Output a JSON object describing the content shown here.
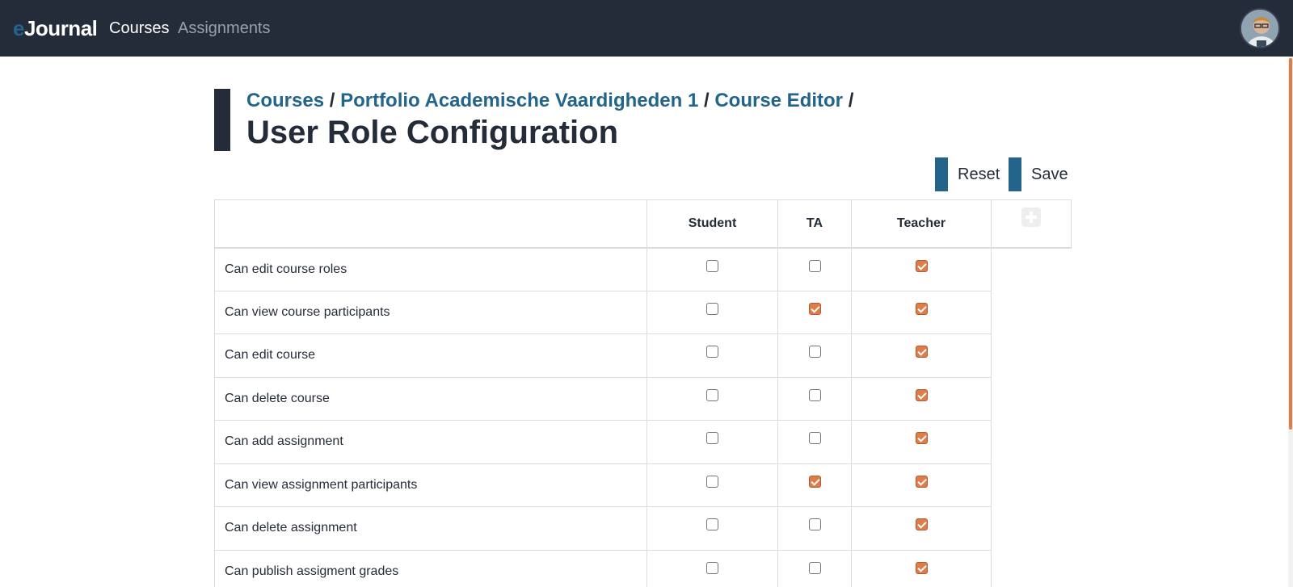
{
  "navbar": {
    "brand_prefix": "e",
    "brand_rest": "Journal",
    "links": [
      "Courses",
      "Assignments"
    ],
    "active_link": "Courses"
  },
  "header": {
    "breadcrumb": [
      "Courses",
      "Portfolio Academische Vaardigheden 1",
      "Course Editor"
    ],
    "separator": "/",
    "title": "User Role Configuration"
  },
  "actions": {
    "reset": "Reset",
    "save": "Save"
  },
  "table": {
    "columns": [
      "Student",
      "TA",
      "Teacher"
    ],
    "rows": [
      {
        "label": "Can edit course roles",
        "values": [
          false,
          false,
          true
        ]
      },
      {
        "label": "Can view course participants",
        "values": [
          false,
          true,
          true
        ]
      },
      {
        "label": "Can edit course",
        "values": [
          false,
          false,
          true
        ]
      },
      {
        "label": "Can delete course",
        "values": [
          false,
          false,
          true
        ]
      },
      {
        "label": "Can add assignment",
        "values": [
          false,
          false,
          true
        ]
      },
      {
        "label": "Can view assignment participants",
        "values": [
          false,
          true,
          true
        ]
      },
      {
        "label": "Can delete assignment",
        "values": [
          false,
          false,
          true
        ]
      },
      {
        "label": "Can publish assigment grades",
        "values": [
          false,
          false,
          true
        ]
      }
    ]
  },
  "icons": {
    "add_role": "plus-square-icon",
    "avatar": "user-avatar"
  },
  "colors": {
    "navbar": "#252c39",
    "accent": "#22648a",
    "checked": "#e07b4a"
  }
}
